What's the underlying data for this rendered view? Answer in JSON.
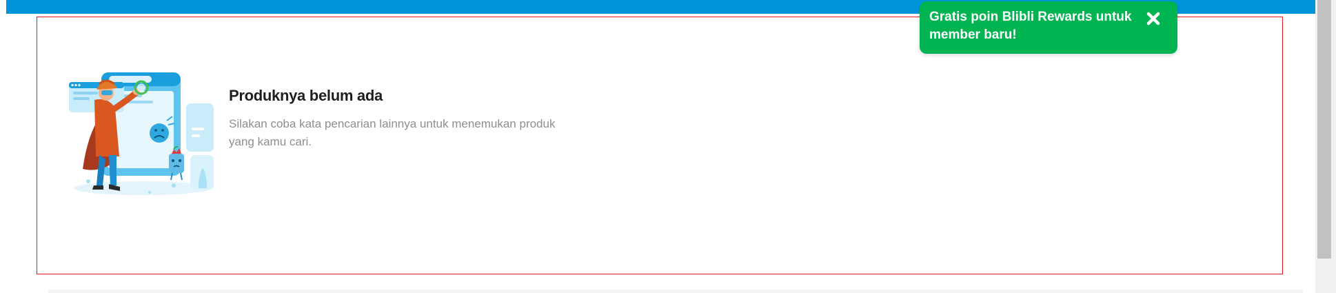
{
  "colors": {
    "brand_blue": "#0095da",
    "toast_green": "#00b451",
    "outline_red": "#e0161d"
  },
  "empty_state": {
    "title": "Produknya belum ada",
    "description": "Silakan coba kata pencarian lainnya untuk menemukan produk yang kamu cari.",
    "illustration": "product-not-found-illustration"
  },
  "toast": {
    "message": "Gratis poin Blibli Rewards untuk member baru!",
    "close_icon": "close-icon"
  }
}
